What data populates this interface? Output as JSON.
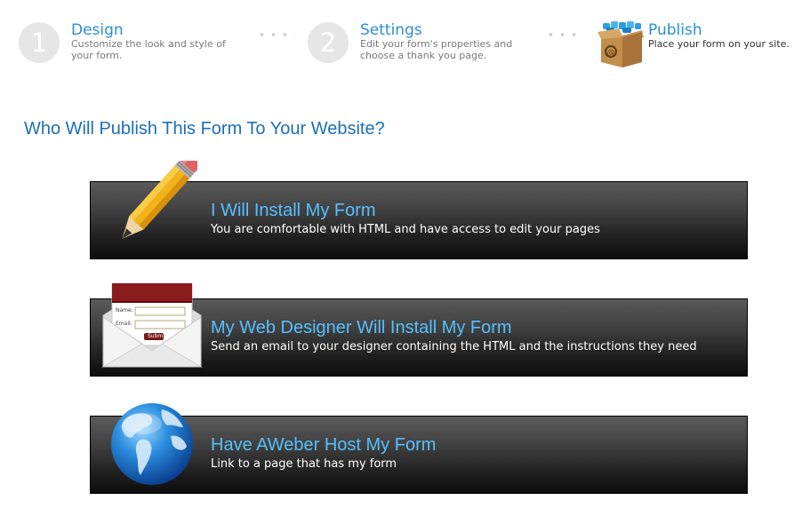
{
  "steps": [
    {
      "number": "1",
      "title": "Design",
      "desc": "Customize the look and style of your form."
    },
    {
      "number": "2",
      "title": "Settings",
      "desc": "Edit your form's properties and choose a thank you page."
    },
    {
      "icon": "package-box-icon",
      "title": "Publish",
      "desc": "Place your form on your site."
    }
  ],
  "heading": "Who Will Publish This Form To Your Website?",
  "options": [
    {
      "icon": "pencil-icon",
      "title": "I Will Install My Form",
      "desc": "You are comfortable with HTML and have access to edit your pages"
    },
    {
      "icon": "envelope-form-icon",
      "title": "My Web Designer Will Install My Form",
      "desc": "Send an email to your designer containing the HTML and the instructions they need"
    },
    {
      "icon": "globe-icon",
      "title": "Have AWeber Host My Form",
      "desc": "Link to a page that has my form"
    }
  ],
  "envelope_form": {
    "name_label": "Name:",
    "email_label": "Email:",
    "submit_label": "Subm"
  },
  "colors": {
    "step_title": "#2b8fd0",
    "heading": "#1c6fb8",
    "option_title": "#55c0ff",
    "option_bg": "#2a2a2a"
  }
}
